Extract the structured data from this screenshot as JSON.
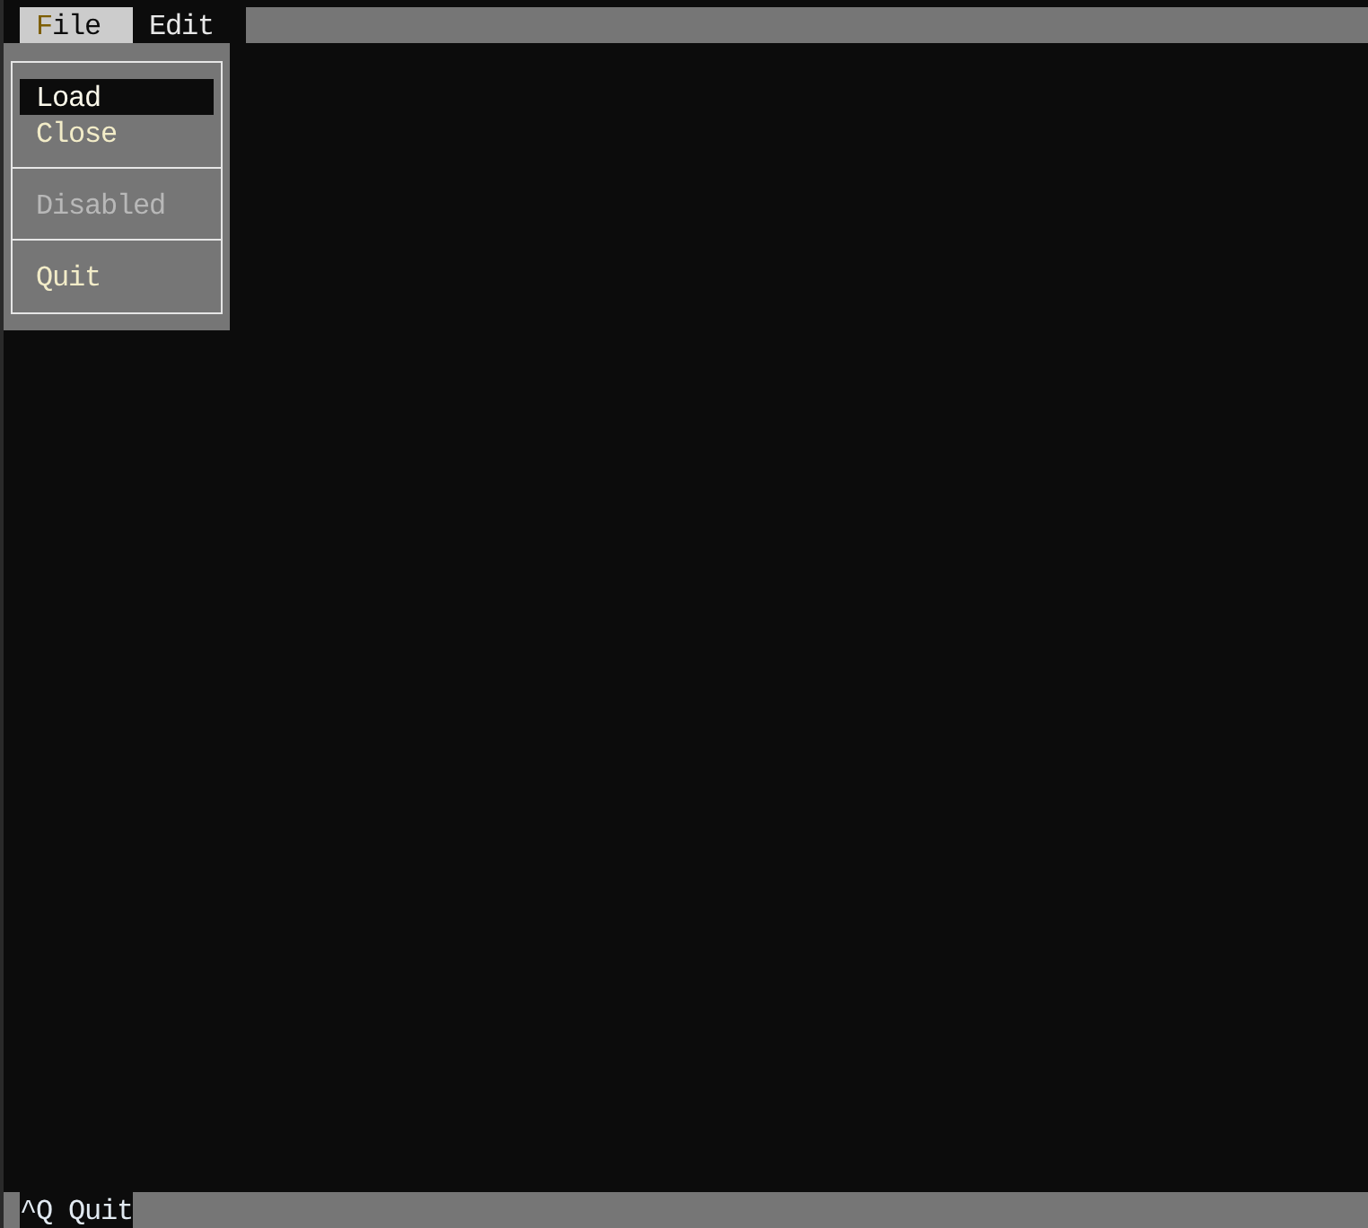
{
  "menu_bar": {
    "menus": [
      {
        "label": "File",
        "selected": true
      },
      {
        "label": "Edit",
        "selected": false
      }
    ]
  },
  "file_menu": {
    "groups": [
      {
        "items": [
          {
            "label": "Load",
            "selected": true,
            "disabled": false
          },
          {
            "label": "Close",
            "selected": false,
            "disabled": false
          }
        ]
      },
      {
        "items": [
          {
            "label": "Disabled",
            "selected": false,
            "disabled": true
          }
        ]
      },
      {
        "items": [
          {
            "label": "Quit",
            "selected": false,
            "disabled": false
          }
        ]
      }
    ]
  },
  "status_bar": {
    "bindings": [
      {
        "key": "^Q",
        "label": "Quit"
      }
    ]
  }
}
